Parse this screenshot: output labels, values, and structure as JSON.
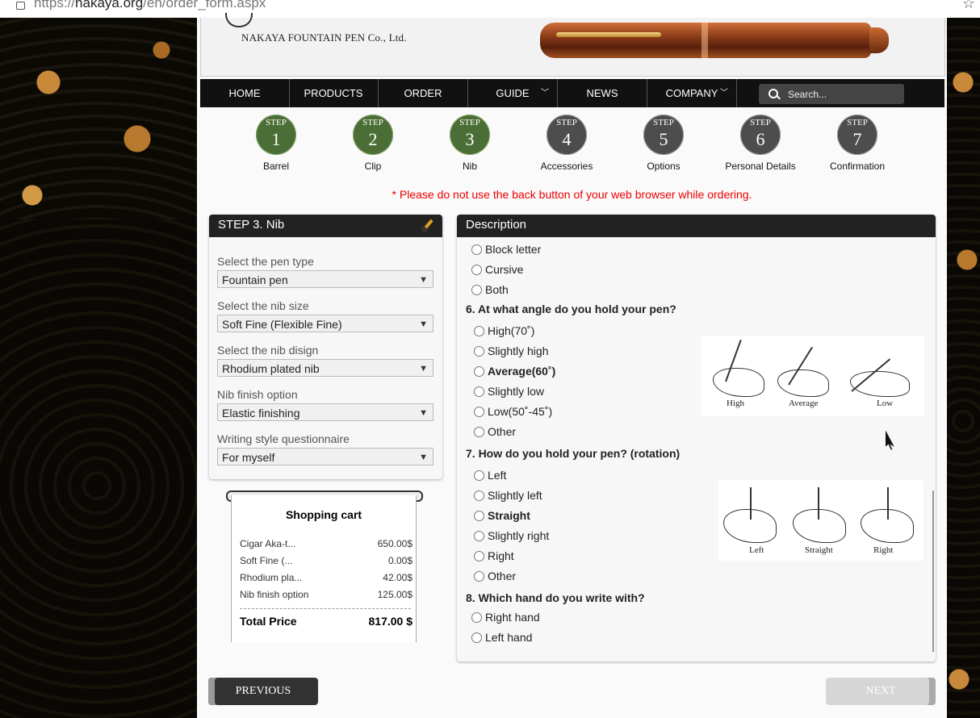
{
  "browser": {
    "url_prefix": "https://",
    "url_host": "nakaya.org",
    "url_path": "/en/order_form.aspx"
  },
  "header": {
    "company": "NAKAYA FOUNTAIN PEN Co., Ltd."
  },
  "nav": {
    "items": [
      "HOME",
      "PRODUCTS",
      "ORDER",
      "GUIDE",
      "NEWS",
      "COMPANY"
    ],
    "search_placeholder": "Search..."
  },
  "steps": [
    {
      "word": "STEP",
      "num": "1",
      "label": "Barrel",
      "state": "done"
    },
    {
      "word": "STEP",
      "num": "2",
      "label": "Clip",
      "state": "done"
    },
    {
      "word": "STEP",
      "num": "3",
      "label": "Nib",
      "state": "done"
    },
    {
      "word": "STEP",
      "num": "4",
      "label": "Accessories",
      "state": "todo"
    },
    {
      "word": "STEP",
      "num": "5",
      "label": "Options",
      "state": "todo"
    },
    {
      "word": "STEP",
      "num": "6",
      "label": "Personal Details",
      "state": "todo"
    },
    {
      "word": "STEP",
      "num": "7",
      "label": "Confirmation",
      "state": "todo"
    }
  ],
  "warning": "* Please do not use the back button of your web browser while ordering.",
  "left_panel": {
    "title": "STEP 3. Nib",
    "fields": [
      {
        "label": "Select the pen type",
        "value": "Fountain pen"
      },
      {
        "label": "Select the nib size",
        "value": "Soft Fine (Flexible Fine)"
      },
      {
        "label": "Select the nib disign",
        "value": "Rhodium plated nib"
      },
      {
        "label": "Nib finish option",
        "value": "Elastic finishing"
      },
      {
        "label": "Writing style questionnaire",
        "value": "For myself"
      }
    ]
  },
  "cart": {
    "title": "Shopping cart",
    "items": [
      {
        "name": "Cigar Aka-t...",
        "amount": "650.00$"
      },
      {
        "name": "Soft Fine (...",
        "amount": "0.00$"
      },
      {
        "name": "Rhodium pla...",
        "amount": "42.00$"
      },
      {
        "name": "Nib finish option",
        "amount": "125.00$"
      }
    ],
    "total_label": "Total Price",
    "total_amount": "817.00 $"
  },
  "description": {
    "title": "Description",
    "top_options": [
      "Block letter",
      "Cursive",
      "Both"
    ],
    "q6": "6. At what angle do you hold your pen?",
    "q6_options": [
      "High(70˚)",
      "Slightly high",
      "Average(60˚)",
      "Slightly low",
      "Low(50˚-45˚)",
      "Other"
    ],
    "q6_captions": [
      "High",
      "Average",
      "Low"
    ],
    "q7": "7. How do you hold your pen? (rotation)",
    "q7_options": [
      "Left",
      "Slightly left",
      "Straight",
      "Slightly right",
      "Right",
      "Other"
    ],
    "q7_captions": [
      "Left",
      "Straight",
      "Right"
    ],
    "q8": "8. Which hand do you write with?",
    "q8_options": [
      "Right hand",
      "Left hand"
    ]
  },
  "buttons": {
    "previous": "PREVIOUS",
    "next": "NEXT"
  },
  "colors": {
    "step_done": "#4a6e35",
    "step_todo": "#4d4d4d",
    "warning": "#ee0000",
    "nav_bg": "#111111"
  }
}
